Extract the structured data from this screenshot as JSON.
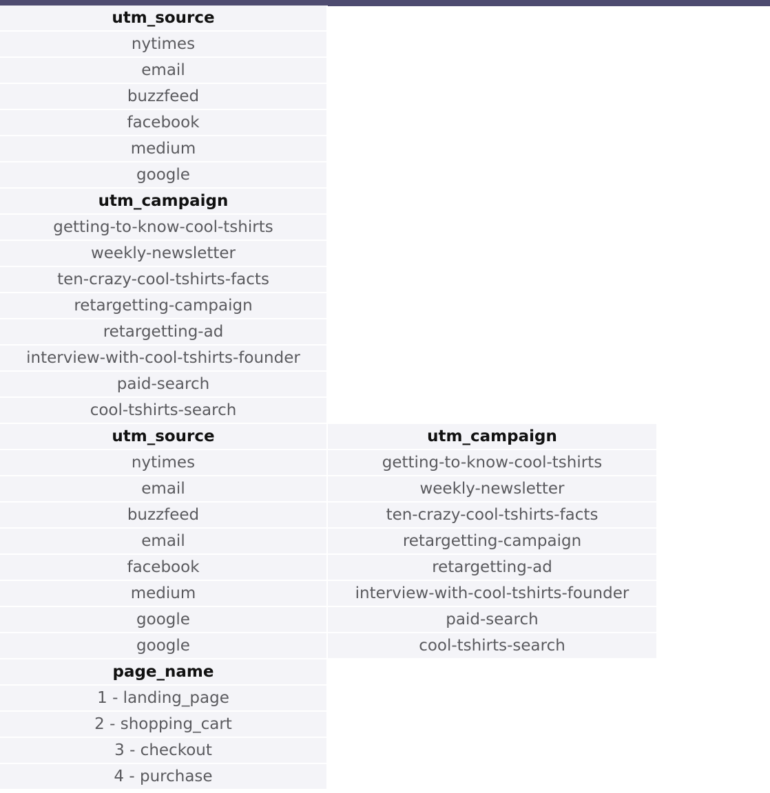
{
  "table1": {
    "header": "utm_source",
    "rows": [
      "nytimes",
      "email",
      "buzzfeed",
      "facebook",
      "medium",
      "google"
    ]
  },
  "table2": {
    "header": "utm_campaign",
    "rows": [
      "getting-to-know-cool-tshirts",
      "weekly-newsletter",
      "ten-crazy-cool-tshirts-facts",
      "retargetting-campaign",
      "retargetting-ad",
      "interview-with-cool-tshirts-founder",
      "paid-search",
      "cool-tshirts-search"
    ]
  },
  "table3": {
    "headers": [
      "utm_source",
      "utm_campaign"
    ],
    "rows": [
      [
        "nytimes",
        "getting-to-know-cool-tshirts"
      ],
      [
        "email",
        "weekly-newsletter"
      ],
      [
        "buzzfeed",
        "ten-crazy-cool-tshirts-facts"
      ],
      [
        "email",
        "retargetting-campaign"
      ],
      [
        "facebook",
        "retargetting-ad"
      ],
      [
        "medium",
        "interview-with-cool-tshirts-founder"
      ],
      [
        "google",
        "paid-search"
      ],
      [
        "google",
        "cool-tshirts-search"
      ]
    ]
  },
  "table4": {
    "header": "page_name",
    "rows": [
      "1 - landing_page",
      "2 - shopping_cart",
      "3 - checkout",
      "4 - purchase"
    ]
  },
  "colors": {
    "topbar": "#4e4b70",
    "cell_bg": "#f4f4f8",
    "cell_text": "#5a5a5e",
    "header_text": "#111111"
  }
}
